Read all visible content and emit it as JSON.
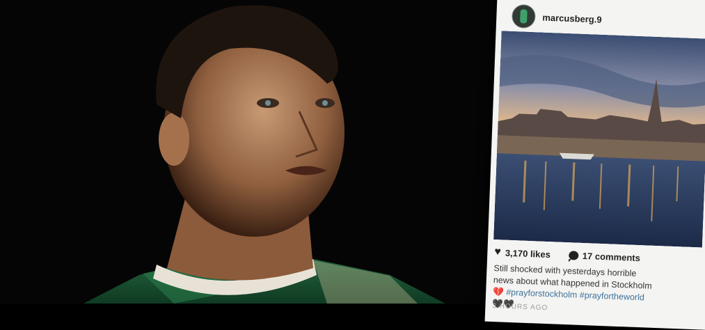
{
  "post": {
    "username": "marcusberg.9",
    "likes": "3,170 likes",
    "comments": "17 comments",
    "caption_text": "Still shocked with yesterdays horrible news about what happened in Stockholm",
    "caption_emoji": "💔",
    "hashtag_1": "#prayforstockholm",
    "hashtag_2": "#prayfortheworld",
    "caption_end_emoji": "🖤🖤",
    "timestamp": "3 HOURS AGO"
  },
  "icons": {
    "like": "heart-icon",
    "comment": "comment-bubble-icon"
  },
  "colors": {
    "background": "#000000",
    "card": "#f4f4f2",
    "hashtag": "#3f729b",
    "jersey": "#1f5b3a"
  }
}
